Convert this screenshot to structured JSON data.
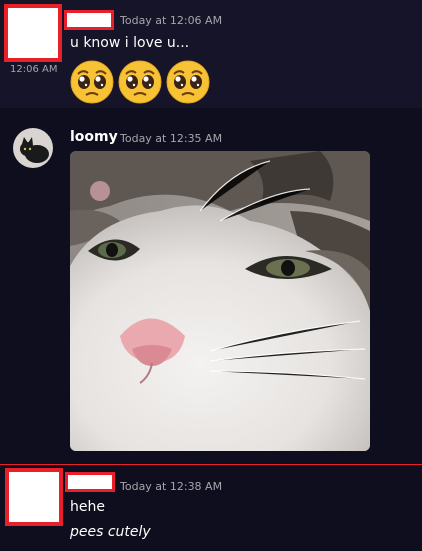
{
  "messages": [
    {
      "author_redacted": true,
      "timestamp": "Today at 12:06 AM",
      "side_time": "12:06 AM",
      "text": "u know i love u...",
      "emojis": [
        "pleading-face",
        "pleading-face",
        "pleading-face"
      ]
    },
    {
      "author": "loomy",
      "timestamp": "Today at 12:35 AM",
      "attachment": "cat-photo"
    },
    {
      "author_redacted": true,
      "timestamp": "Today at 12:38 AM",
      "text_1": "hehe",
      "text_2": "pees cutely"
    }
  ],
  "colors": {
    "background": "#0f0e1e",
    "redaction_border": "#e8202a",
    "new_messages_divider": "#e8202a"
  }
}
